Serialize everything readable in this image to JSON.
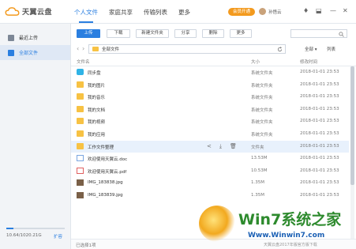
{
  "app": {
    "logo_text": "天翼云盘"
  },
  "nav": [
    "个人文件",
    "家庭共享",
    "传输列表",
    "更多"
  ],
  "header": {
    "vip_label": "会员开通",
    "username": "孙悟云",
    "controls": [
      "♦",
      "⬓",
      "—",
      "✕"
    ]
  },
  "sidebar": {
    "items": [
      {
        "label": "最近上传"
      },
      {
        "label": "全部文件"
      }
    ],
    "storage_used_fraction": 0.0104,
    "quota_text": "10.64/1020.21G",
    "expand_label": "扩容"
  },
  "toolbar": {
    "buttons": [
      "上传",
      "下载",
      "新建文件夹",
      "分享",
      "删除",
      "更多"
    ]
  },
  "pathbar": {
    "path": "全部文件",
    "sort_label": "全部 ▾",
    "view_label": "列表"
  },
  "columns": {
    "name": "文件名",
    "size": "大小",
    "date": "修改时间"
  },
  "files": [
    {
      "name": "同步盘",
      "size": "系统文件夹",
      "date": "2018-01-01 23:53",
      "type": "sync"
    },
    {
      "name": "我的图片",
      "size": "系统文件夹",
      "date": "2018-01-01 23:53",
      "type": "folder"
    },
    {
      "name": "我的音乐",
      "size": "系统文件夹",
      "date": "2018-01-01 23:53",
      "type": "folder"
    },
    {
      "name": "我的文档",
      "size": "系统文件夹",
      "date": "2018-01-01 23:53",
      "type": "folder"
    },
    {
      "name": "我的视频",
      "size": "系统文件夹",
      "date": "2018-01-01 23:53",
      "type": "folder"
    },
    {
      "name": "我的应用",
      "size": "系统文件夹",
      "date": "2018-01-01 23:53",
      "type": "folder"
    },
    {
      "name": "工作文件整理",
      "size": "文件夹",
      "date": "2018-01-01 23:53",
      "type": "folder"
    },
    {
      "name": "欢迎使用天翼云.doc",
      "size": "13.53M",
      "date": "2018-01-01 23:53",
      "type": "doc"
    },
    {
      "name": "欢迎使用天翼云.pdf",
      "size": "10.53M",
      "date": "2018-01-01 23:53",
      "type": "pdf"
    },
    {
      "name": "IMG_183838.jpg",
      "size": "1.35M",
      "date": "2018-01-01 23:53",
      "type": "img"
    },
    {
      "name": "IMG_183839.jpg",
      "size": "1.35M",
      "date": "2018-01-01 23:53",
      "type": "img"
    }
  ],
  "row_actions": [
    "share-icon",
    "download-icon",
    "delete-icon"
  ],
  "status": {
    "text": "已选择1项"
  },
  "watermark": {
    "brand": "Win7系统之家",
    "site": "Www.Winwin7.com",
    "footer": "天翼云盘2017年版官方版下载"
  },
  "colors": {
    "accent": "#2b7fe0",
    "folder": "#f7c244",
    "vip": "#f39a1e",
    "highlight": "#e8f1fc"
  }
}
